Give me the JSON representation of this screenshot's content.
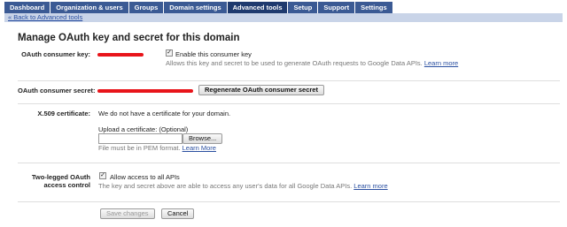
{
  "nav": {
    "tabs": [
      {
        "label": "Dashboard"
      },
      {
        "label": "Organization & users"
      },
      {
        "label": "Groups"
      },
      {
        "label": "Domain settings"
      },
      {
        "label": "Advanced tools"
      },
      {
        "label": "Setup"
      },
      {
        "label": "Support"
      },
      {
        "label": "Settings"
      }
    ],
    "active_tab": "Advanced tools",
    "back_link": "« Back to Advanced tools"
  },
  "page": {
    "title": "Manage OAuth key and secret for this domain"
  },
  "consumer_key": {
    "label": "OAuth consumer key:",
    "enable_label": "Enable this consumer key",
    "enable_checked": true,
    "help": "Allows this key and secret to be used to generate OAuth requests to Google Data APIs.",
    "learn_more": "Learn more"
  },
  "consumer_secret": {
    "label": "OAuth consumer secret:",
    "regenerate_button": "Regenerate OAuth consumer secret"
  },
  "certificate": {
    "label": "X.509 certificate:",
    "status": "We do not have a certificate for your domain.",
    "upload_label": "Upload a certificate: (Optional)",
    "browse_button": "Browse...",
    "format_note": "File must be in PEM format.",
    "learn_more": "Learn More"
  },
  "two_legged": {
    "label": "Two-legged OAuth access control",
    "allow_label": "Allow access to all APIs",
    "allow_checked": true,
    "help": "The key and secret above are able to access any user's data for all Google Data APIs.",
    "learn_more": "Learn more"
  },
  "actions": {
    "save": "Save changes",
    "cancel": "Cancel"
  },
  "colors": {
    "tab": "#3b5a94",
    "tab_active": "#1f3a6e",
    "subbar": "#c9d4e8",
    "link": "#2a4fa0",
    "redaction": "#e8141a"
  }
}
